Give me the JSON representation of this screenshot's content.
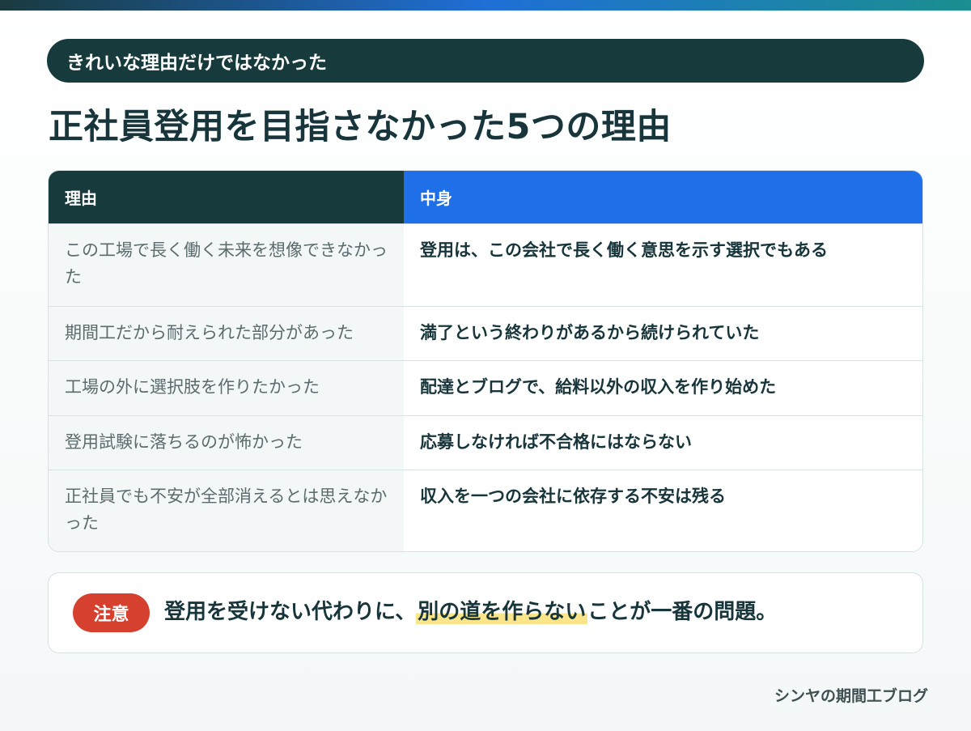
{
  "header": {
    "pill_text": "きれいな理由だけではなかった",
    "title": "正社員登用を目指さなかった5つの理由"
  },
  "table": {
    "columns": [
      "理由",
      "中身"
    ],
    "rows": [
      {
        "reason": "この工場で長く働く未来を想像できなかった",
        "detail": "登用は、この会社で長く働く意思を示す選択でもある"
      },
      {
        "reason": "期間工だから耐えられた部分があった",
        "detail": "満了という終わりがあるから続けられていた"
      },
      {
        "reason": "工場の外に選択肢を作りたかった",
        "detail": "配達とブログで、給料以外の収入を作り始めた"
      },
      {
        "reason": "登用試験に落ちるのが怖かった",
        "detail": "応募しなければ不合格にはならない"
      },
      {
        "reason": "正社員でも不安が全部消えるとは思えなかった",
        "detail": "収入を一つの会社に依存する不安は残る"
      }
    ]
  },
  "note": {
    "badge": "注意",
    "text_before": "登用を受けない代わりに、",
    "text_highlight": "別の道を作らない",
    "text_after": "ことが一番の問題。"
  },
  "footer": {
    "credit": "シンヤの期間工ブログ"
  },
  "colors": {
    "dark_teal": "#173a3d",
    "blue": "#1f6fe8",
    "alert_red": "#d6402f",
    "highlight_yellow": "#fbe58a"
  }
}
